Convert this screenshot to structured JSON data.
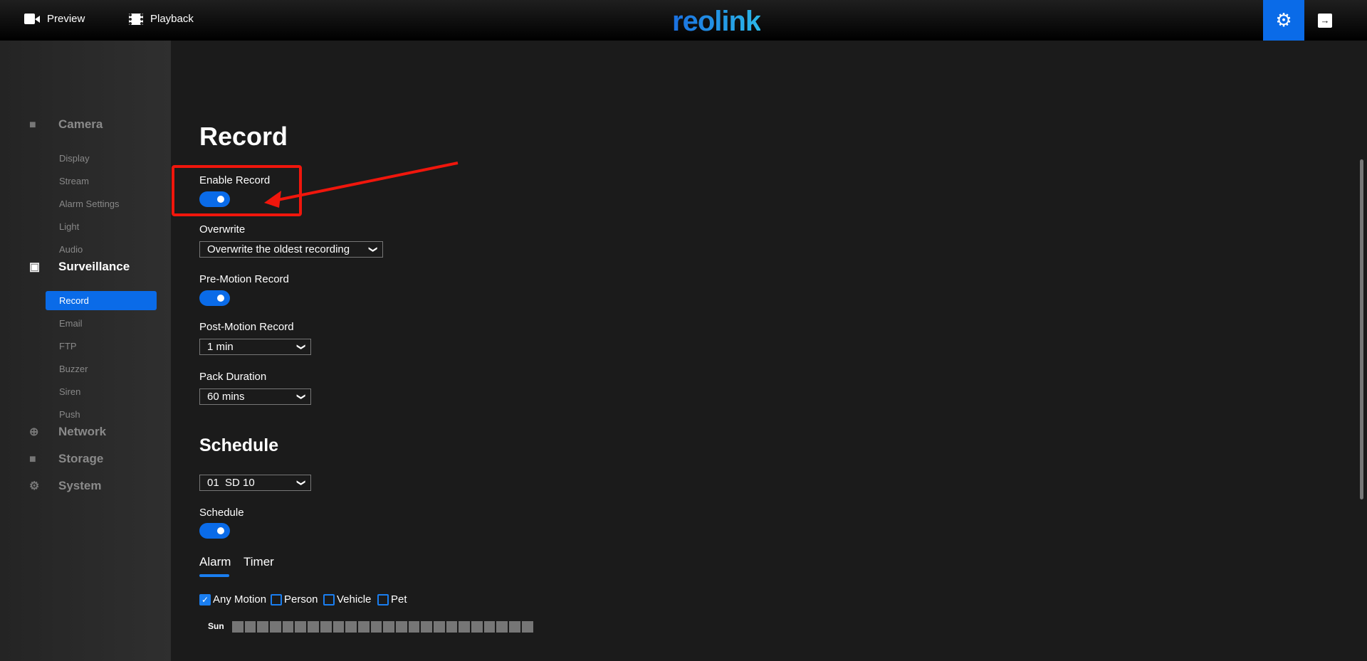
{
  "header": {
    "preview": "Preview",
    "playback": "Playback",
    "logo": "reolink",
    "settings_icon": "gear-icon",
    "logout_icon": "exit-icon",
    "accent": "#0a6be8"
  },
  "sidebar": {
    "camera": {
      "label": "Camera",
      "items": [
        "Display",
        "Stream",
        "Alarm Settings",
        "Light",
        "Audio"
      ]
    },
    "surveillance": {
      "label": "Surveillance",
      "items": [
        "Record",
        "Email",
        "FTP",
        "Buzzer",
        "Siren",
        "Push"
      ],
      "active": "Record"
    },
    "network": "Network",
    "storage": "Storage",
    "system": "System"
  },
  "record": {
    "title": "Record",
    "enable_record": {
      "label": "Enable Record",
      "on": true
    },
    "overwrite": {
      "label": "Overwrite",
      "value": "Overwrite the oldest recording"
    },
    "pre_motion": {
      "label": "Pre-Motion Record",
      "on": true
    },
    "post_motion": {
      "label": "Post-Motion Record",
      "value": "1 min"
    },
    "pack_duration": {
      "label": "Pack Duration",
      "value": "60 mins"
    }
  },
  "schedule": {
    "title": "Schedule",
    "channel_num": "01",
    "channel_name": "SD 10",
    "toggle": {
      "label": "Schedule",
      "on": true
    },
    "tabs": [
      "Alarm",
      "Timer"
    ],
    "active_tab": "Alarm",
    "types": [
      {
        "label": "Any Motion",
        "checked": true
      },
      {
        "label": "Person",
        "checked": false
      },
      {
        "label": "Vehicle",
        "checked": false
      },
      {
        "label": "Pet",
        "checked": false
      }
    ],
    "day": "Sun",
    "hours": 24
  }
}
